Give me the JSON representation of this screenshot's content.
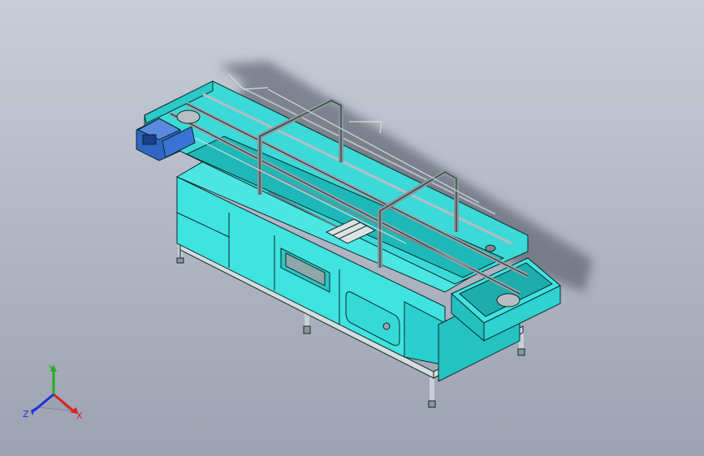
{
  "viewport": {
    "background_top": "#c9cdd7",
    "background_bottom": "#9ca2b1"
  },
  "model": {
    "body_color": "#3fe3e0",
    "body_shade_color": "#25c2c2",
    "edge_color": "#0c2a2a",
    "frame_color": "#c9d0d4",
    "motor_color": "#2f66c6",
    "rail_color": "#9aa3a8"
  },
  "triad": {
    "x_label": "X",
    "y_label": "Y",
    "z_label": "Z",
    "x_color": "#e02020",
    "y_color": "#20b020",
    "z_color": "#2030e0"
  }
}
